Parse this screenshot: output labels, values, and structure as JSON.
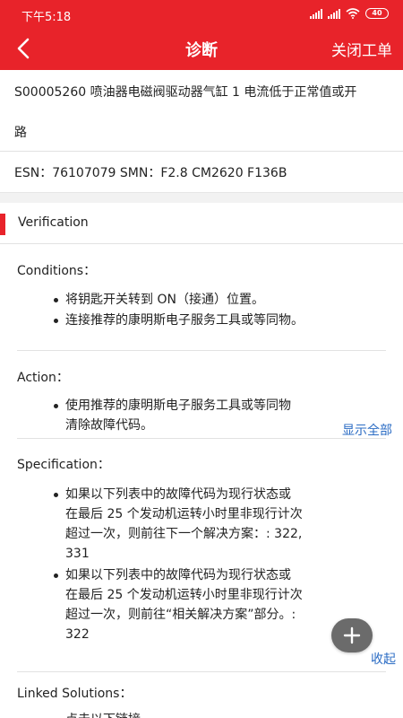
{
  "status_bar": {
    "time": "下午5:18",
    "battery": "40"
  },
  "nav": {
    "title": "诊断",
    "close_label": "关闭工单"
  },
  "fault": {
    "line1": "S00005260 喷油器电磁阀驱动器气缸 1 电流低于正常值或开",
    "line2": "路"
  },
  "esn_line": "ESN：76107079 SMN：F2.8 CM2620 F136B",
  "verification": {
    "title": "Verification",
    "conditions_label": "Conditions：",
    "conditions": [
      "将钥匙开关转到 ON（接通）位置。",
      "连接推荐的康明斯电子服务工具或等同物。"
    ],
    "action_label": "Action：",
    "action_lines": [
      "使用推荐的康明斯电子服务工具或等同物",
      "清除故障代码。"
    ],
    "show_all": "显示全部",
    "specification_label": "Specification：",
    "spec_item1_lines": [
      "如果以下列表中的故障代码为现行状态或",
      "在最后 25 个发动机运转小时里非现行计次",
      "超过一次，则前往下一个解决方案：: 322,",
      "331"
    ],
    "spec_item2_lines": [
      "如果以下列表中的故障代码为现行状态或",
      "在最后 25 个发动机运转小时里非现行计次",
      "超过一次，则前往“相关解决方案”部分。:",
      "322"
    ],
    "collapse": "收起",
    "linked_label": "Linked Solutions：",
    "linked_partial": "点击以下链接"
  },
  "icons": {
    "back": "chevron-left-icon",
    "fab": "plus-icon"
  },
  "colors": {
    "brand_red": "#e8232a",
    "link_blue": "#2b6cc4",
    "fab_gray": "#6b6b6b"
  }
}
